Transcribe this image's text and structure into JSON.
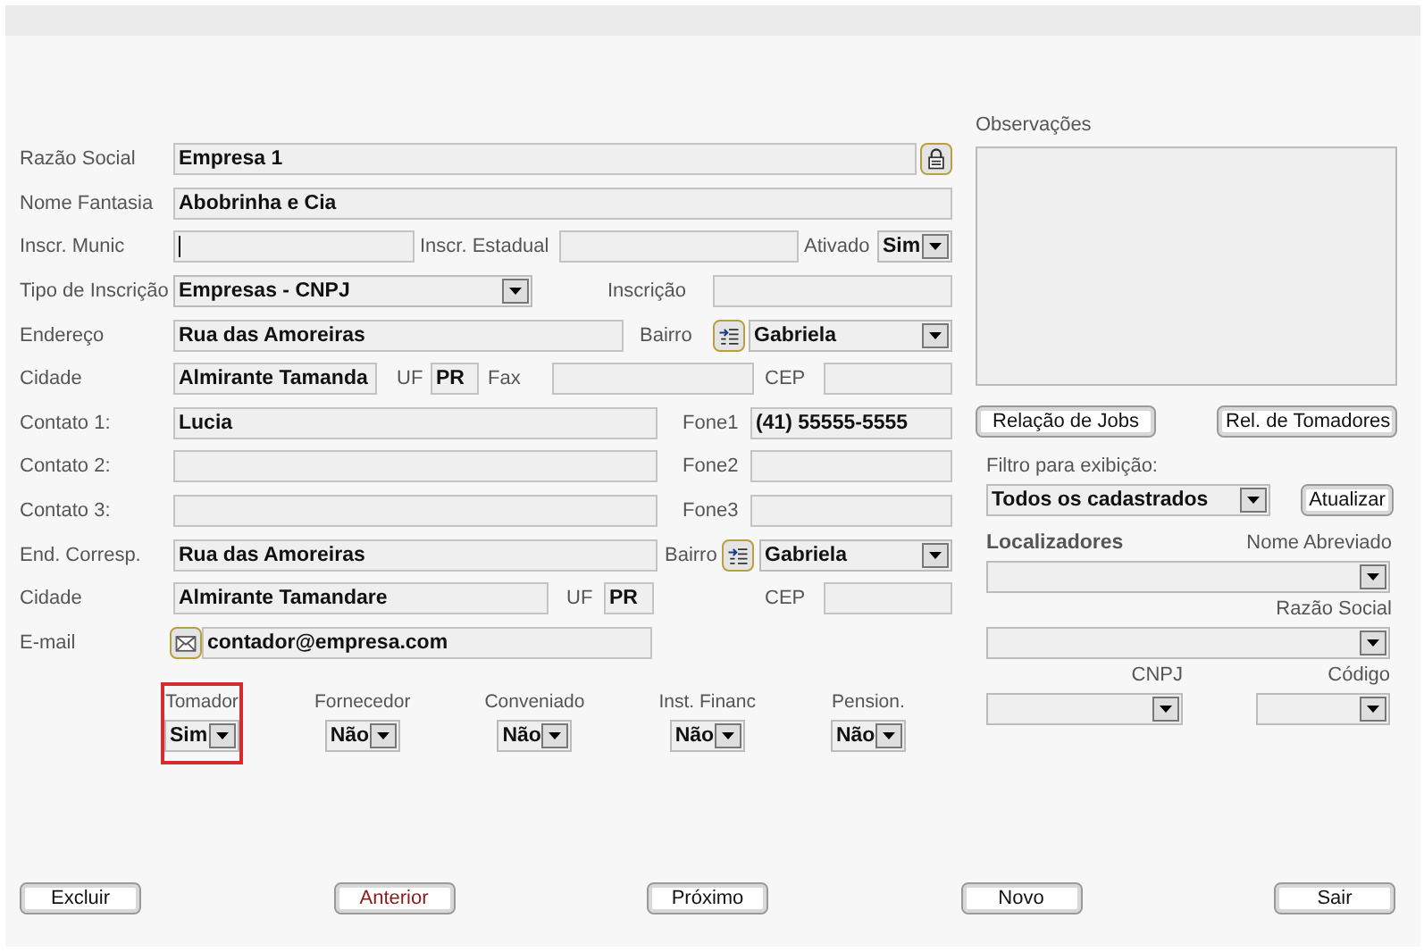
{
  "form": {
    "rows": [
      {
        "items": [
          {
            "kind": "label",
            "text": "Razão Social"
          },
          {
            "kind": "field",
            "value": "Empresa 1"
          },
          {
            "kind": "lock-button"
          }
        ]
      },
      {
        "items": [
          {
            "kind": "label",
            "text": "Nome Fantasia"
          },
          {
            "kind": "field",
            "value": "Abobrinha e Cia"
          }
        ]
      },
      {
        "items": [
          {
            "kind": "label",
            "text": "Inscr. Munic"
          },
          {
            "kind": "field",
            "focused": true
          },
          {
            "kind": "label",
            "text": "Inscr. Estadual"
          },
          {
            "kind": "field"
          },
          {
            "kind": "label",
            "text": "Ativado"
          },
          {
            "kind": "dropdown",
            "value": "Sim"
          }
        ]
      },
      {
        "items": [
          {
            "kind": "label",
            "text": "Tipo de Inscrição"
          },
          {
            "kind": "dropdown",
            "value": "Empresas - CNPJ"
          },
          {
            "kind": "label",
            "text": "Inscrição"
          },
          {
            "kind": "field"
          }
        ]
      },
      {
        "items": [
          {
            "kind": "label",
            "text": "Endereço"
          },
          {
            "kind": "field",
            "value": "Rua das Amoreiras"
          },
          {
            "kind": "label",
            "text": "Bairro"
          },
          {
            "kind": "list-button"
          },
          {
            "kind": "dropdown",
            "value": "Gabriela"
          }
        ]
      },
      {
        "items": [
          {
            "kind": "label",
            "text": "Cidade"
          },
          {
            "kind": "field",
            "value": "Almirante Tamanda"
          },
          {
            "kind": "label",
            "text": "UF"
          },
          {
            "kind": "field",
            "value": "PR"
          },
          {
            "kind": "label",
            "text": "Fax"
          },
          {
            "kind": "field"
          },
          {
            "kind": "label",
            "text": "CEP"
          },
          {
            "kind": "field"
          }
        ]
      },
      {
        "items": [
          {
            "kind": "label",
            "text": "Contato 1:"
          },
          {
            "kind": "field",
            "value": "Lucia"
          },
          {
            "kind": "label",
            "text": "Fone1"
          },
          {
            "kind": "field",
            "value": "(41) 55555-5555"
          }
        ]
      },
      {
        "items": [
          {
            "kind": "label",
            "text": "Contato 2:"
          },
          {
            "kind": "field"
          },
          {
            "kind": "label",
            "text": "Fone2"
          },
          {
            "kind": "field"
          }
        ]
      },
      {
        "items": [
          {
            "kind": "label",
            "text": "Contato 3:"
          },
          {
            "kind": "field"
          },
          {
            "kind": "label",
            "text": "Fone3"
          },
          {
            "kind": "field"
          }
        ]
      },
      {
        "items": [
          {
            "kind": "label",
            "text": "End. Corresp."
          },
          {
            "kind": "field",
            "value": "Rua das Amoreiras"
          },
          {
            "kind": "label",
            "text": "Bairro"
          },
          {
            "kind": "list-button"
          },
          {
            "kind": "dropdown",
            "value": "Gabriela"
          }
        ]
      },
      {
        "items": [
          {
            "kind": "label",
            "text": "Cidade"
          },
          {
            "kind": "field",
            "value": "Almirante Tamandare"
          },
          {
            "kind": "label",
            "text": "UF"
          },
          {
            "kind": "field",
            "value": "PR"
          },
          {
            "kind": "label",
            "text": "CEP"
          },
          {
            "kind": "field"
          }
        ]
      },
      {
        "items": [
          {
            "kind": "label",
            "text": "E-mail"
          },
          {
            "kind": "mail-button"
          },
          {
            "kind": "field",
            "value": "contador@empresa.com"
          }
        ]
      }
    ]
  },
  "flags": [
    {
      "label": "Tomador",
      "value": "Sim",
      "highlighted": true
    },
    {
      "label": "Fornecedor",
      "value": "Não",
      "highlighted": false
    },
    {
      "label": "Conveniado",
      "value": "Não",
      "highlighted": false
    },
    {
      "label": "Inst. Financ",
      "value": "Não",
      "highlighted": false
    },
    {
      "label": "Pension.",
      "value": "Não",
      "highlighted": false
    }
  ],
  "observations": {
    "label": "Observações"
  },
  "report_buttons": [
    "Relação de Jobs",
    "Rel. de Tomadores"
  ],
  "filter": {
    "label": "Filtro para exibição:",
    "value": "Todos os cadastrados",
    "button": "Atualizar"
  },
  "locators": {
    "title": "Localizadores",
    "labels": [
      "Nome Abreviado",
      "Razão Social",
      "CNPJ",
      "Código"
    ]
  },
  "actions": [
    {
      "label": "Excluir",
      "focused": false
    },
    {
      "label": "Anterior",
      "focused": true
    },
    {
      "label": "Próximo",
      "focused": false
    },
    {
      "label": "Novo",
      "focused": false
    },
    {
      "label": "Sair",
      "focused": false
    }
  ]
}
